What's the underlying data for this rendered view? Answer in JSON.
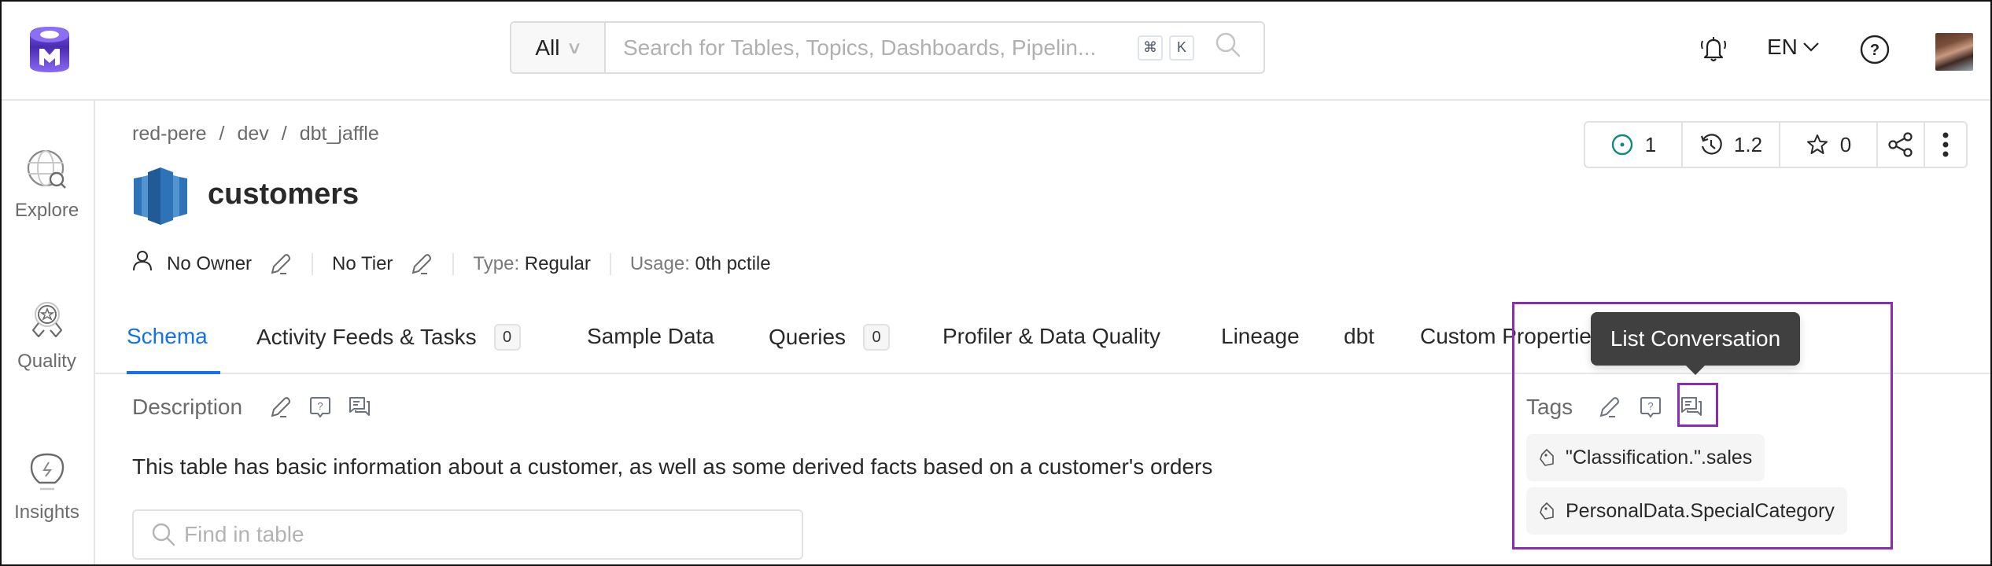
{
  "header": {
    "logo_name": "OpenMetadata",
    "search": {
      "filter_value": "All",
      "placeholder": "Search for Tables, Topics, Dashboards, Pipelin...",
      "shortcut_keys": [
        "⌘",
        "K"
      ]
    },
    "language": "EN",
    "brand_color": "#7147e8"
  },
  "sidebar": {
    "items": [
      {
        "label": "Explore",
        "icon": "globe-search-icon"
      },
      {
        "label": "Quality",
        "icon": "award-badge-icon"
      },
      {
        "label": "Insights",
        "icon": "lightbulb-icon"
      }
    ]
  },
  "entity": {
    "breadcrumb": [
      "red-pere",
      "dev",
      "dbt_jaffle"
    ],
    "breadcrumb_separator": "/",
    "title": "customers",
    "meta": {
      "owner": "No Owner",
      "tier": "No Tier",
      "type_label": "Type:",
      "type_value": "Regular",
      "usage_label": "Usage:",
      "usage_value": "0th pctile"
    },
    "actions": {
      "followers": "1",
      "version": "1.2",
      "stars": "0"
    }
  },
  "tabs": [
    {
      "label": "Schema",
      "active": true
    },
    {
      "label": "Activity Feeds & Tasks",
      "count": "0"
    },
    {
      "label": "Sample Data"
    },
    {
      "label": "Queries",
      "count": "0"
    },
    {
      "label": "Profiler & Data Quality"
    },
    {
      "label": "Lineage"
    },
    {
      "label": "dbt"
    },
    {
      "label": "Custom Properties"
    }
  ],
  "description": {
    "title": "Description",
    "text": "This table has basic information about a customer, as well as some derived facts based on a customer's orders"
  },
  "find_in_table": {
    "placeholder": "Find in table"
  },
  "tags": {
    "title": "Tags",
    "items": [
      "\"Classification.\".sales",
      "PersonalData.SpecialCategory"
    ]
  },
  "tooltip": {
    "text": "List Conversation"
  },
  "colors": {
    "accent": "#1470ef",
    "highlight": "#8a2cb5",
    "follow": "#0f8a7e"
  }
}
